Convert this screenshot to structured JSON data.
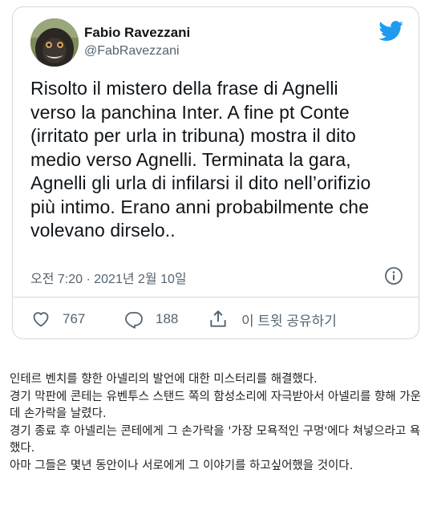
{
  "tweet": {
    "author_name": "Fabio Ravezzani",
    "author_handle": "@FabRavezzani",
    "text": "Risolto il mistero della frase di Agnelli\nverso la panchina Inter. A fine pt Conte\n(irritato per urla in tribuna) mostra il dito\nmedio verso Agnelli. Terminata la gara,\nAgnelli gli urla di infilarsi il dito nell’orifizio\npiù intimo. Erano anni probabilmente che\nvolevano dirselo..",
    "timestamp": "오전 7:20 · 2021년 2월 10일",
    "likes": "767",
    "replies": "188",
    "share_label": "이 트윗 공유하기"
  },
  "caption": {
    "lines": [
      "인테르 벤치를 향한 아넬리의 발언에 대한 미스터리를 해결했다.",
      "경기 막판에 콘테는 유벤투스 스탠드 쪽의 함성소리에 자극받아서 아넬리를 향해 가운데 손가락을 날렸다.",
      "경기 종료 후 아넬리는 콘테에게 그 손가락을 '가장 모욕적인 구멍'에다 쳐넣으라고 욕했다.",
      "아마 그들은 몇년 동안이나 서로에게 그 이야기를 하고싶어했을 것이다."
    ]
  },
  "icons": {
    "brand": "twitter-bird-icon",
    "info": "info-icon",
    "like": "heart-icon",
    "reply": "reply-bubble-icon",
    "share": "share-icon"
  },
  "colors": {
    "brand_blue": "#1d9bf0",
    "text_primary": "#0f1419",
    "text_secondary": "#536471",
    "border": "#cfd9de"
  }
}
